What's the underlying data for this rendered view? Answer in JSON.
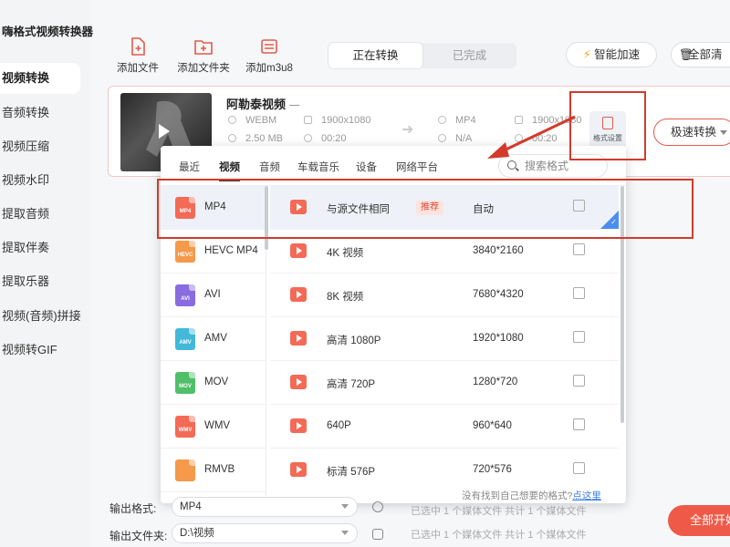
{
  "app": {
    "title": "嗨格式视频转换器"
  },
  "sidebar": {
    "items": [
      {
        "label": "视频转换"
      },
      {
        "label": "音频转换"
      },
      {
        "label": "视频压缩"
      },
      {
        "label": "视频水印"
      },
      {
        "label": "提取音频"
      },
      {
        "label": "提取伴奏"
      },
      {
        "label": "提取乐器"
      },
      {
        "label": "视频(音频)拼接"
      },
      {
        "label": "视频转GIF"
      }
    ]
  },
  "toolbar": {
    "add_file": "添加文件",
    "add_folder": "添加文件夹",
    "add_m3u8": "添加m3u8",
    "tabs": [
      "正在转换",
      "已完成"
    ],
    "smart_accel": "智能加速",
    "clear_all": "全部清"
  },
  "file": {
    "name": "阿勒泰视频",
    "src_format": "WEBM",
    "src_resolution": "1900x1080",
    "src_size": "2.50 MB",
    "src_duration": "00:20",
    "dst_format": "MP4",
    "dst_resolution": "1900x1080",
    "dst_size": "N/A",
    "dst_duration": "00:20",
    "format_settings": "格式设置",
    "convert_mode": "极速转换"
  },
  "dialog": {
    "tabs": [
      "最近",
      "视频",
      "音频",
      "车载音乐",
      "设备",
      "网络平台"
    ],
    "active_tab": "视频",
    "search_placeholder": "搜索格式",
    "formats": [
      {
        "label": "MP4",
        "icon": "MP4",
        "color": "#f36a56"
      },
      {
        "label": "HEVC MP4",
        "icon": "HEVC",
        "color": "#f59a4a"
      },
      {
        "label": "AVI",
        "icon": "AVI",
        "color": "#8a6be0"
      },
      {
        "label": "AMV",
        "icon": "AMV",
        "color": "#43b8d8"
      },
      {
        "label": "MOV",
        "icon": "MOV",
        "color": "#4fbf6a"
      },
      {
        "label": "WMV",
        "icon": "WMV",
        "color": "#f36a56"
      },
      {
        "label": "RMVB",
        "icon": "",
        "color": "#f59a4a"
      }
    ],
    "options": [
      {
        "name": "与源文件相同",
        "res": "自动",
        "tag": "推荐"
      },
      {
        "name": "4K 视频",
        "res": "3840*2160"
      },
      {
        "name": "8K 视频",
        "res": "7680*4320"
      },
      {
        "name": "高清 1080P",
        "res": "1920*1080"
      },
      {
        "name": "高清 720P",
        "res": "1280*720"
      },
      {
        "name": "640P",
        "res": "960*640"
      },
      {
        "name": "标清 576P",
        "res": "720*576"
      }
    ],
    "footer_text": "没有找到自己想要的格式?",
    "footer_link": "点这里"
  },
  "bottom": {
    "output_format_label": "输出格式:",
    "output_format_value": "MP4",
    "output_folder_label": "输出文件夹:",
    "output_folder_value": "D:\\视频",
    "info1": "已选中 1 个媒体文件 共计 1 个媒体文件",
    "info2": "已选中 1 个媒体文件 共计 1 个媒体文件",
    "start_all": "全部开始"
  },
  "colors": {
    "accent": "#ef5a48",
    "annotation": "#d33a2c",
    "link": "#3d7ee6"
  }
}
